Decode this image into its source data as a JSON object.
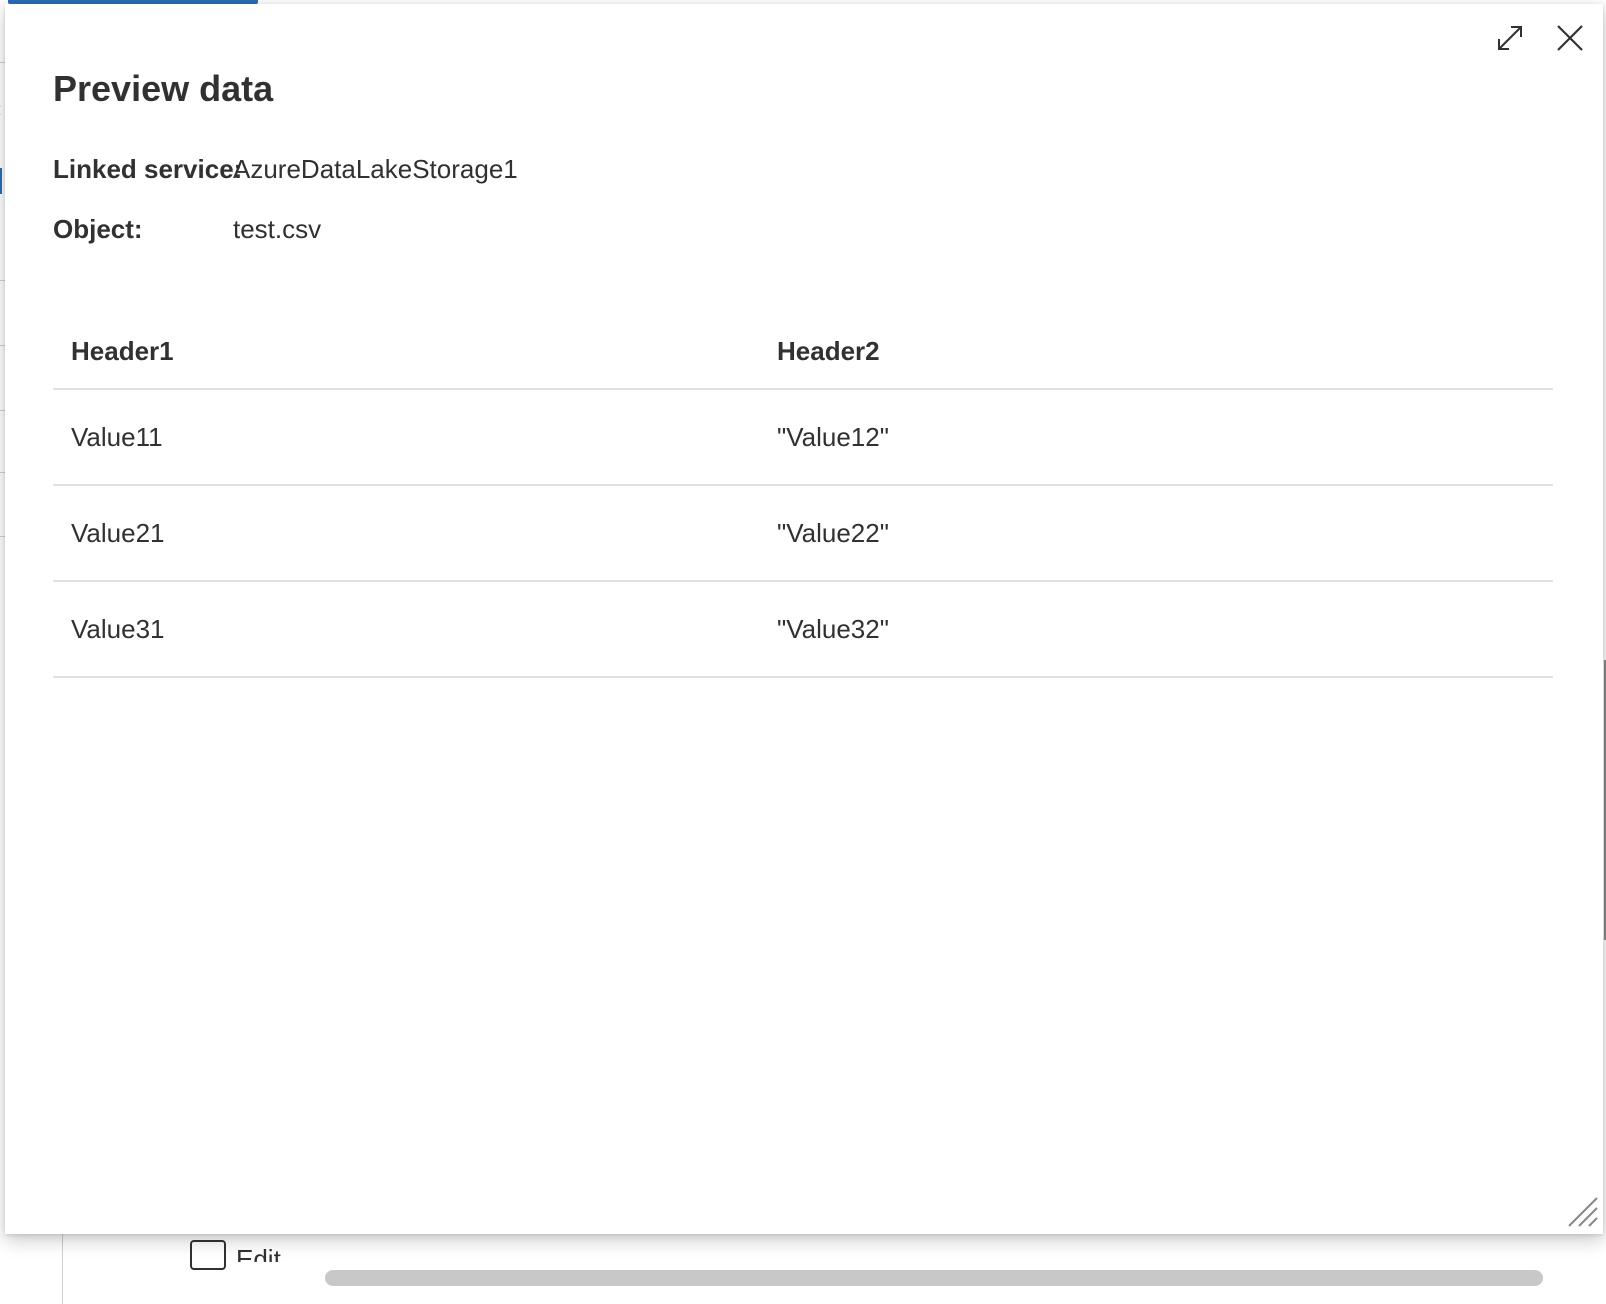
{
  "background": {
    "checkbox_label": "Edit"
  },
  "dialog": {
    "title": "Preview data",
    "linked_service_label": "Linked service:",
    "linked_service_value": "AzureDataLakeStorage1",
    "object_label": "Object:",
    "object_value": "test.csv",
    "icons": {
      "expand": "expand-icon",
      "close": "close-icon",
      "resize": "resize-grip-icon"
    }
  },
  "table": {
    "headers": [
      "Header1",
      "Header2"
    ],
    "rows": [
      [
        "Value11",
        "\"Value12\""
      ],
      [
        "Value21",
        "\"Value22\""
      ],
      [
        "Value31",
        "\"Value32\""
      ]
    ]
  },
  "colors": {
    "accent": "#2b6cb8",
    "text": "#323130",
    "divider": "#e1dfdd"
  }
}
